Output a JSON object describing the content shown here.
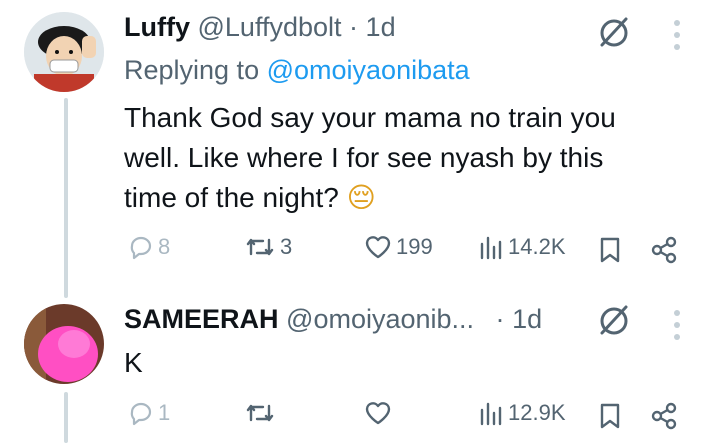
{
  "tweets": [
    {
      "display_name": "Luffy",
      "handle": "@Luffydbolt",
      "separator": "·",
      "time": "1d",
      "replying_label": "Replying to",
      "replying_to": "@omoiyaonibata",
      "text_line1": "Thank God say your mama no train you",
      "text_line2": "well. Like where I for see nyash by this",
      "text_line3": "time of the night?",
      "emoji": "😔",
      "replies": "8",
      "reposts": "3",
      "likes": "199",
      "views": "14.2K"
    },
    {
      "display_name": "SAMEERAH",
      "handle": "@omoiyaonib...",
      "separator": "·",
      "time": "1d",
      "text": "K",
      "replies": "1",
      "reposts": "",
      "likes": "",
      "views": "12.9K"
    }
  ],
  "icons": {
    "grok": "slashed-circle-icon",
    "more": "vertical-dots-icon",
    "reply": "speech-bubble-icon",
    "repost": "retweet-icon",
    "like": "heart-icon",
    "views": "bar-chart-icon",
    "bookmark": "bookmark-icon",
    "share": "share-icon"
  },
  "colors": {
    "text": "#0f1419",
    "secondary": "#536471",
    "link": "#1d9bf0",
    "thread_line": "#cfd9de"
  }
}
